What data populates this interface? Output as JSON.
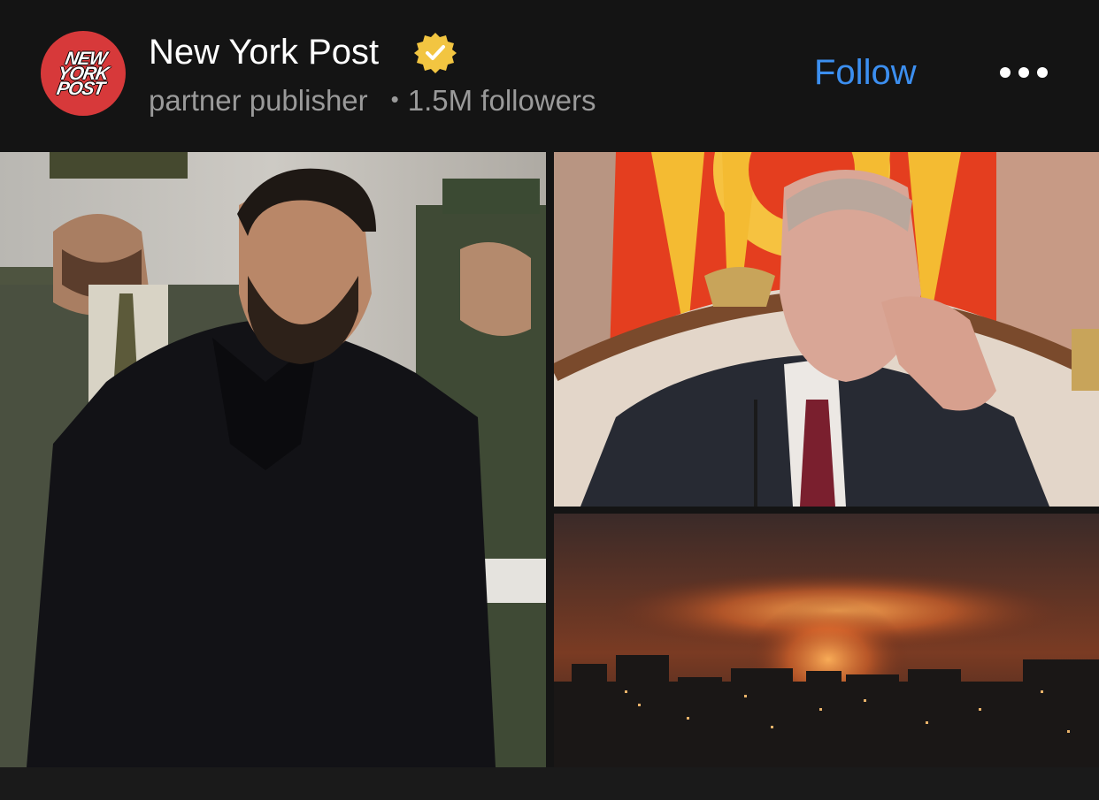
{
  "publisher": {
    "logo_text": [
      "NEW",
      "YORK",
      "POST"
    ],
    "name": "New York Post",
    "role": "partner publisher",
    "separator": "•",
    "followers": "1.5M followers",
    "verified_icon": "verified-badge-icon",
    "brand_color": "#d7393a"
  },
  "actions": {
    "follow_label": "Follow",
    "follow_color": "#3c8ff0",
    "more_icon": "more-horizontal-icon"
  },
  "images": [
    {
      "icon": "photo-man-black-jacket-honor-guard"
    },
    {
      "icon": "photo-man-seated-ornate-chair-flag"
    },
    {
      "icon": "photo-city-skyline-night-explosion"
    }
  ]
}
